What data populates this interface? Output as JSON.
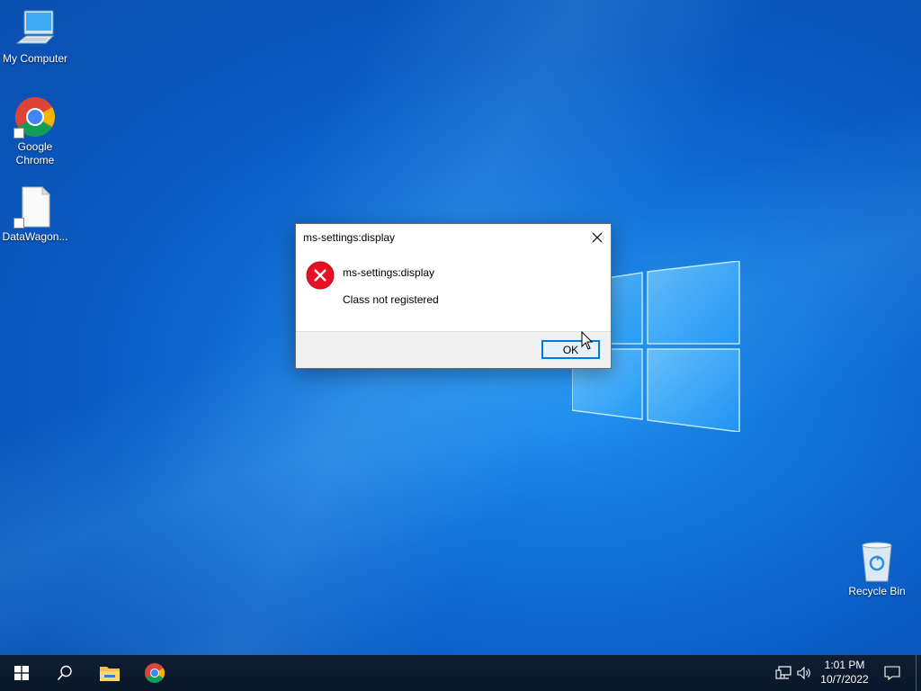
{
  "desktop": {
    "icons": [
      {
        "label": "My Computer"
      },
      {
        "label": "Google Chrome"
      },
      {
        "label": "DataWagon..."
      },
      {
        "label": "Recycle Bin"
      }
    ]
  },
  "dialog": {
    "title": "ms-settings:display",
    "heading": "ms-settings:display",
    "message": "Class not registered",
    "ok_label": "OK",
    "icon": "error-icon"
  },
  "taskbar": {
    "items": [
      {
        "name": "start-icon"
      },
      {
        "name": "search-icon"
      },
      {
        "name": "file-explorer-icon"
      },
      {
        "name": "chrome-icon"
      }
    ],
    "tray": {
      "network_icon": "network-icon",
      "volume_icon": "volume-icon"
    },
    "clock": {
      "time": "1:01 PM",
      "date": "10/7/2022"
    },
    "notification_icon": "action-center-icon"
  },
  "colors": {
    "accent": "#0078d7",
    "error_red": "#e81123",
    "taskbar": "#0b1a2e"
  }
}
